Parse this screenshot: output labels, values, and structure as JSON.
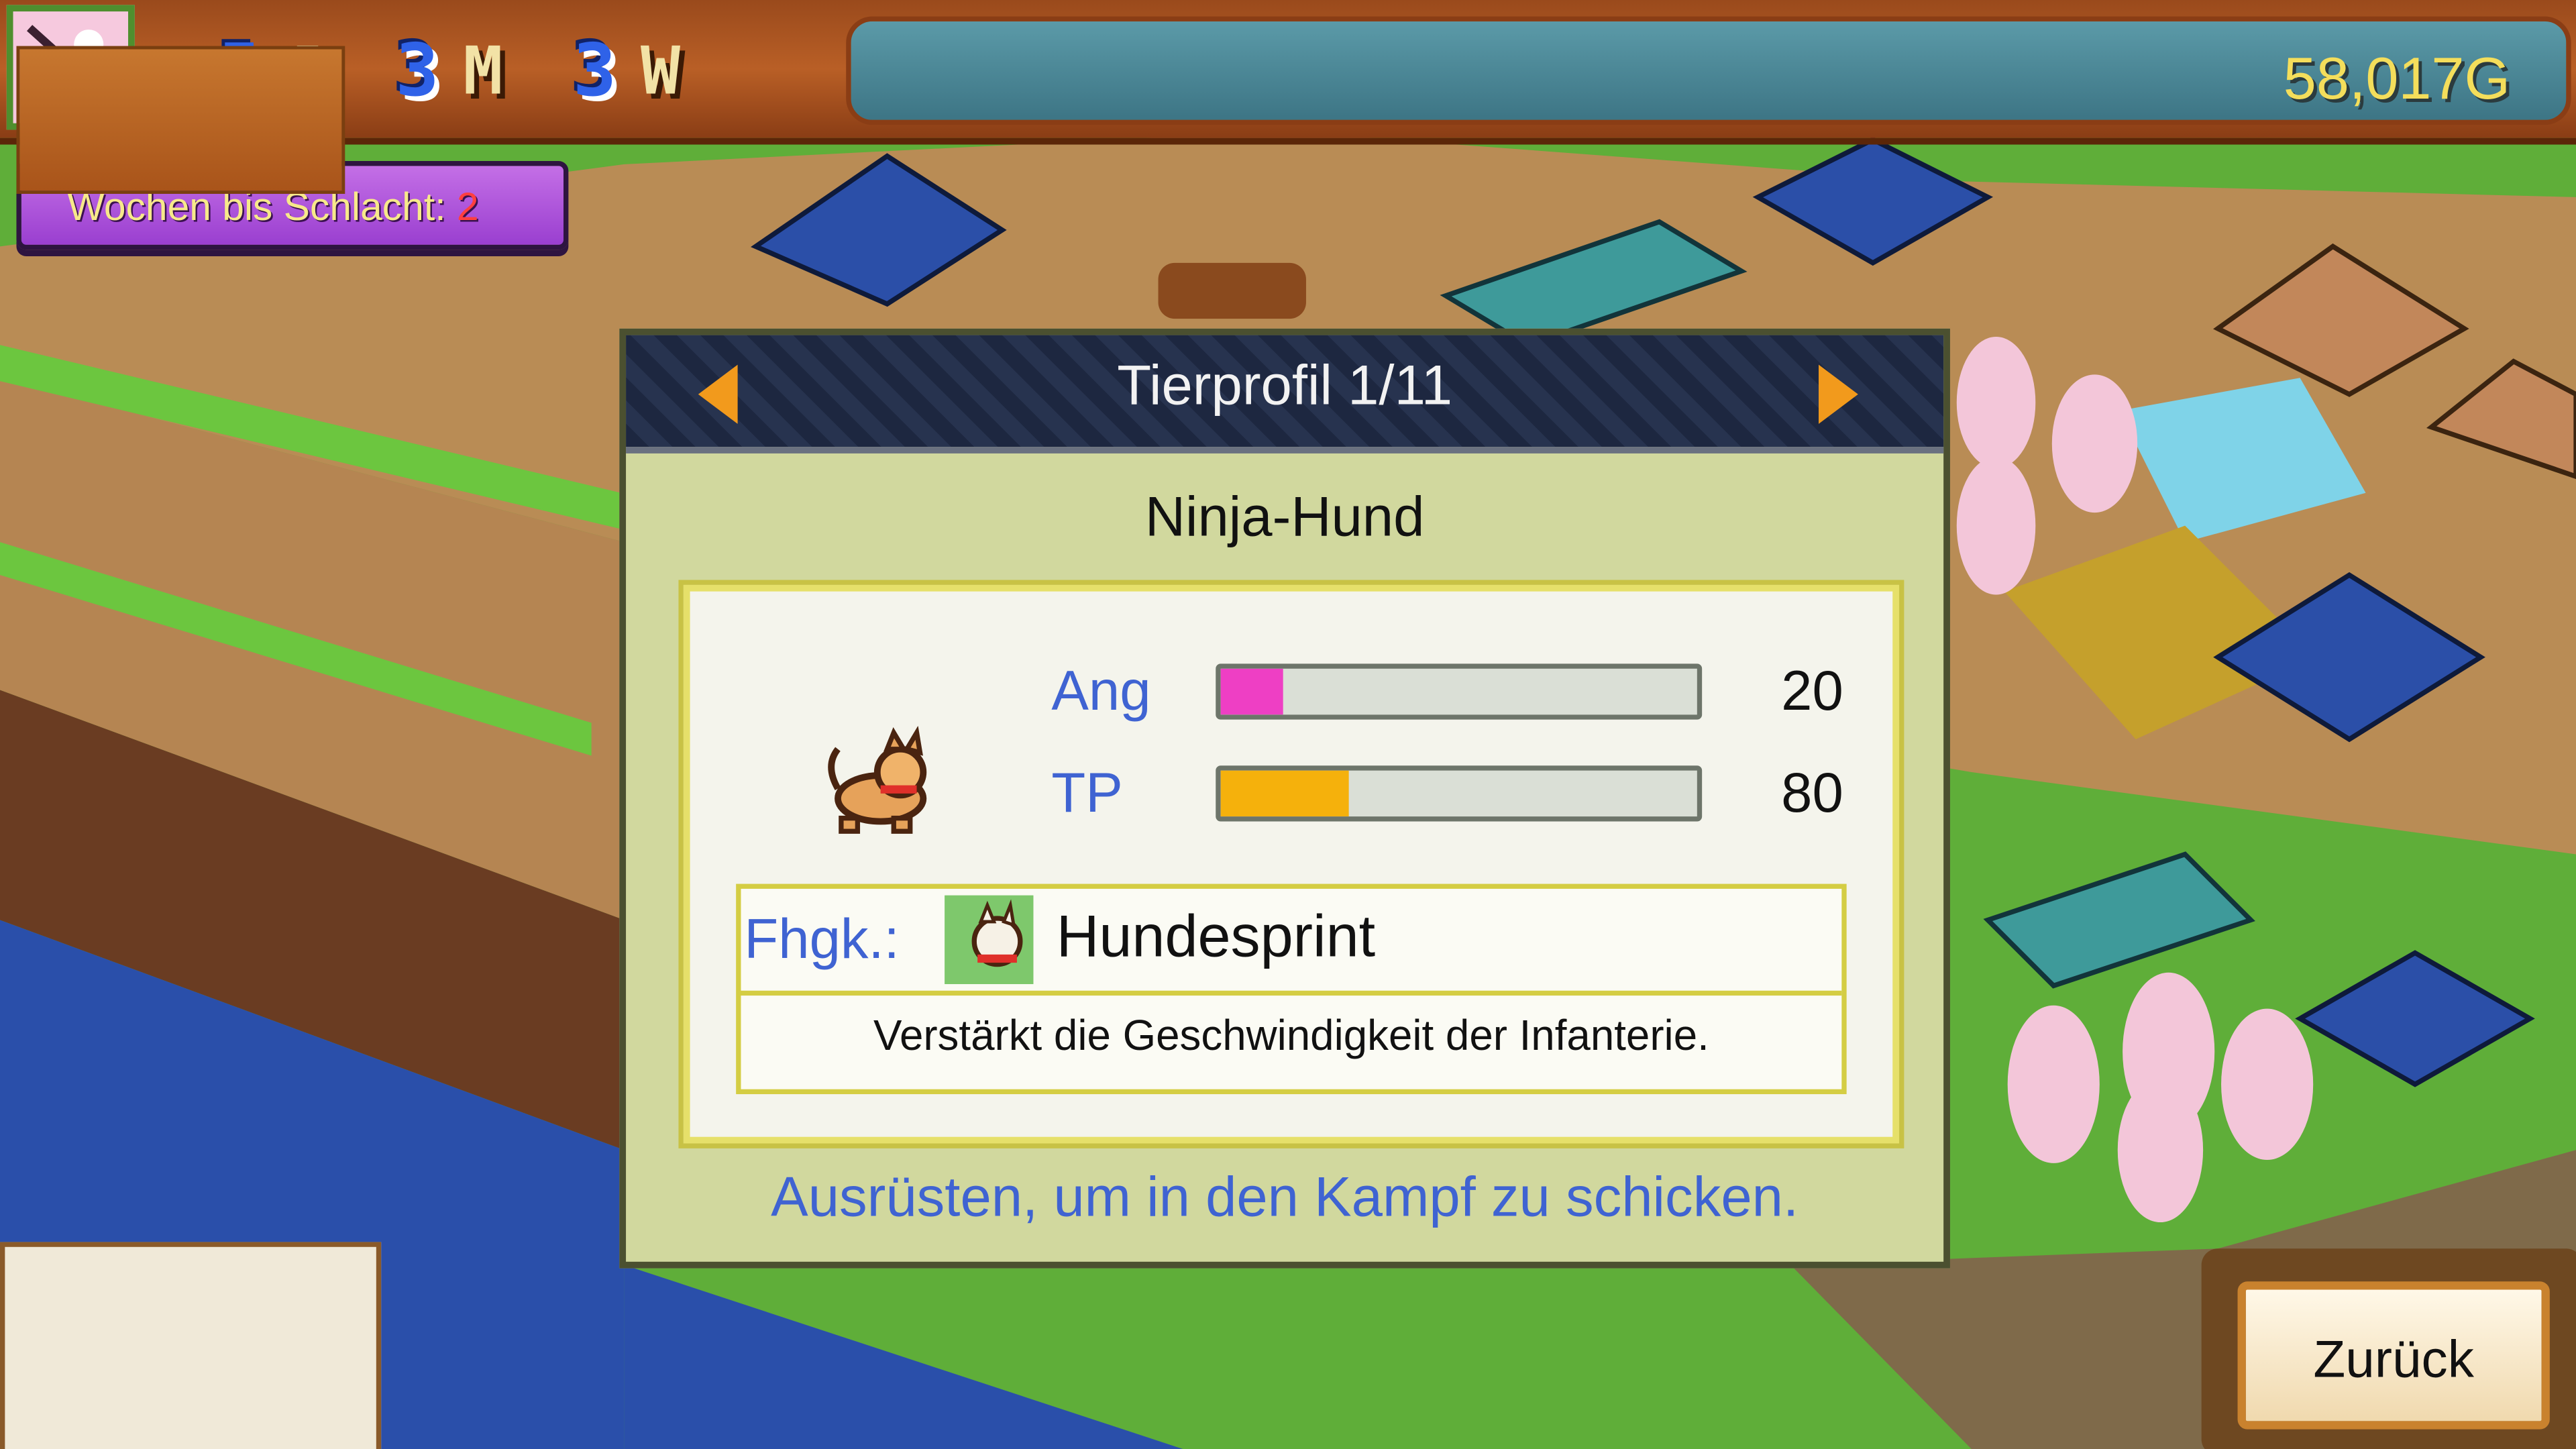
{
  "top_bar": {
    "date": {
      "year_value": "5",
      "year_unit": "J",
      "month_value": "3",
      "month_unit": "M",
      "week_value": "3",
      "week_unit": "W"
    },
    "gold": "58,017G"
  },
  "battle_timer": {
    "label": "Wochen bis Schlacht:",
    "value": "2"
  },
  "dialog": {
    "title": "Tierprofil 1/11",
    "animal_name": "Ninja-Hund",
    "stats": [
      {
        "label": "Ang",
        "value": "20",
        "fraction": 0.13,
        "color": "#ee3fc4"
      },
      {
        "label": "TP",
        "value": "80",
        "fraction": 0.27,
        "color": "#f5b10c"
      }
    ],
    "skill": {
      "label": "Fhgk.:",
      "name": "Hundesprint",
      "icon": "dog-skill-icon",
      "description": "Verstärkt die Geschwindigkeit der Infanterie."
    },
    "hint": "Ausrüsten, um in den Kampf zu schicken."
  },
  "buttons": {
    "back": "Zurück"
  },
  "colors": {
    "accent_blue": "#3f63d2",
    "dialog_bg": "#d1d89e",
    "gold_text": "#f4de5b",
    "arrow": "#f29a1c"
  }
}
